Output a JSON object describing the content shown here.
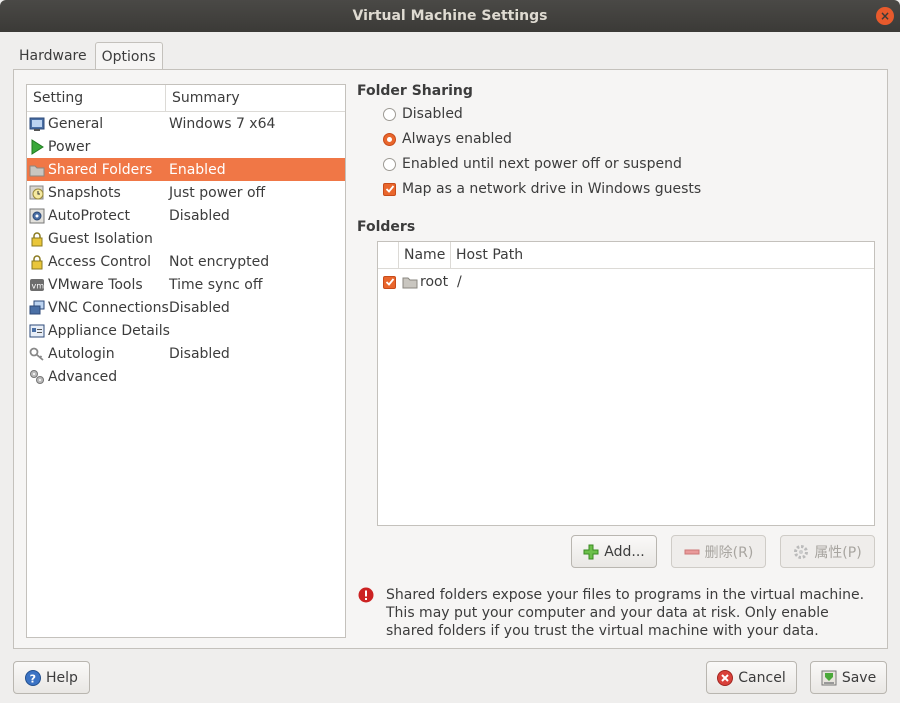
{
  "window": {
    "title": "Virtual Machine Settings",
    "close_glyph": "×"
  },
  "tabs": [
    {
      "label": "Hardware",
      "active": false
    },
    {
      "label": "Options",
      "active": true
    }
  ],
  "settings_list": {
    "headers": {
      "setting": "Setting",
      "summary": "Summary"
    },
    "items": [
      {
        "setting": "General",
        "summary": "Windows 7 x64",
        "icon": "general-icon"
      },
      {
        "setting": "Power",
        "summary": "",
        "icon": "power-play-icon"
      },
      {
        "setting": "Shared Folders",
        "summary": "Enabled",
        "icon": "folder-icon",
        "selected": true
      },
      {
        "setting": "Snapshots",
        "summary": "Just power off",
        "icon": "snapshot-clock-icon"
      },
      {
        "setting": "AutoProtect",
        "summary": "Disabled",
        "icon": "autoprotect-icon"
      },
      {
        "setting": "Guest Isolation",
        "summary": "",
        "icon": "lock-icon"
      },
      {
        "setting": "Access Control",
        "summary": "Not encrypted",
        "icon": "lock-icon"
      },
      {
        "setting": "VMware Tools",
        "summary": "Time sync off",
        "icon": "vmware-tools-icon"
      },
      {
        "setting": "VNC Connections",
        "summary": "Disabled",
        "icon": "vnc-icon"
      },
      {
        "setting": "Appliance Details",
        "summary": "",
        "icon": "appliance-icon"
      },
      {
        "setting": "Autologin",
        "summary": "Disabled",
        "icon": "key-icon"
      },
      {
        "setting": "Advanced",
        "summary": "",
        "icon": "gears-icon"
      }
    ]
  },
  "folder_sharing": {
    "title": "Folder Sharing",
    "options": [
      {
        "label": "Disabled",
        "selected": false
      },
      {
        "label": "Always enabled",
        "selected": true
      },
      {
        "label": "Enabled until next power off or suspend",
        "selected": false
      }
    ],
    "map_drive": {
      "label": "Map as a network drive in Windows guests",
      "checked": true
    }
  },
  "folders": {
    "title": "Folders",
    "headers": {
      "name": "Name",
      "host_path": "Host Path"
    },
    "rows": [
      {
        "checked": true,
        "name": "root",
        "host_path": "/"
      }
    ]
  },
  "folder_buttons": {
    "add": "Add...",
    "remove": "删除(R)",
    "properties": "属性(P)"
  },
  "warning": {
    "text": "Shared folders expose your files to programs in the virtual machine. This may put your computer and your data at risk. Only enable shared folders if you trust the virtual machine with your data."
  },
  "footer": {
    "help": "Help",
    "cancel": "Cancel",
    "save": "Save"
  },
  "colors": {
    "accent": "#f07746",
    "titlebar": "#3b3a37",
    "close": "#e85a2c",
    "warning": "#cc2222"
  }
}
